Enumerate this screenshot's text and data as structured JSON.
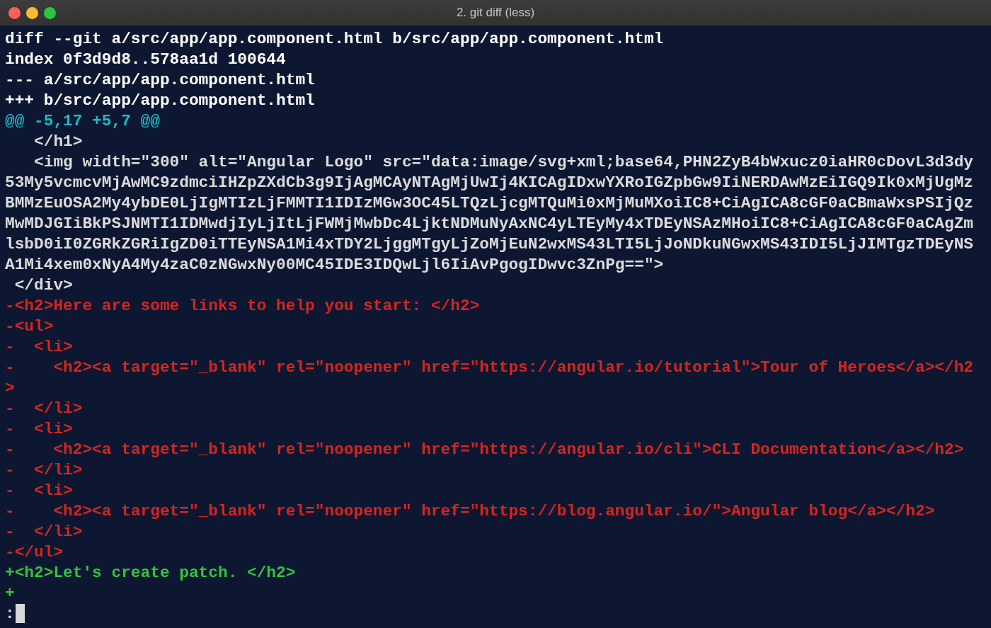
{
  "window": {
    "title": "2. git diff (less)"
  },
  "lines": [
    {
      "kind": "header",
      "text": "diff --git a/src/app/app.component.html b/src/app/app.component.html"
    },
    {
      "kind": "header",
      "text": "index 0f3d9d8..578aa1d 100644"
    },
    {
      "kind": "header",
      "text": "--- a/src/app/app.component.html"
    },
    {
      "kind": "header",
      "text": "+++ b/src/app/app.component.html"
    },
    {
      "kind": "hunk",
      "text": "@@ -5,17 +5,7 @@"
    },
    {
      "kind": "context",
      "text": "   </h1>"
    },
    {
      "kind": "context",
      "text": "   <img width=\"300\" alt=\"Angular Logo\" src=\"data:image/svg+xml;base64,PHN2ZyB4bWxucz0iaHR0cDovL3d3dy"
    },
    {
      "kind": "context",
      "text": "53My5vcmcvMjAwMC9zdmciIHZpZXdCb3g9IjAgMCAyNTAgMjUwIj4KICAgIDxwYXRoIGZpbGw9IiNERDAwMzEiIGQ9Ik0xMjUgMz"
    },
    {
      "kind": "context",
      "text": "BMMzEuOSA2My4ybDE0LjIgMTIzLjFMMTI1IDIzMGw3OC45LTQzLjcgMTQuMi0xMjMuMXoiIC8+CiAgICA8cGF0aCBmaWxsPSIjQz"
    },
    {
      "kind": "context",
      "text": "MwMDJGIiBkPSJNMTI1IDMwdjIyLjItLjFWMjMwbDc4LjktNDMuNyAxNC4yLTEyMy4xTDEyNSAzMHoiIC8+CiAgICA8cGF0aCAgZm"
    },
    {
      "kind": "context",
      "text": "lsbD0iI0ZGRkZGRiIgZD0iTTEyNSA1Mi4xTDY2LjggMTgyLjZoMjEuN2wxMS43LTI5LjJoNDkuNGwxMS43IDI5LjJIMTgzTDEyNS"
    },
    {
      "kind": "context",
      "text": "A1Mi4xem0xNyA4My4zaC0zNGwxNy00MC45IDE3IDQwLjl6IiAvPgogIDwvc3ZnPg==\">"
    },
    {
      "kind": "context",
      "text": " </div>"
    },
    {
      "kind": "removed",
      "text": "-<h2>Here are some links to help you start: </h2>"
    },
    {
      "kind": "removed",
      "text": "-<ul>"
    },
    {
      "kind": "removed",
      "text": "-  <li>"
    },
    {
      "kind": "removed",
      "text": "-    <h2><a target=\"_blank\" rel=\"noopener\" href=\"https://angular.io/tutorial\">Tour of Heroes</a></h2"
    },
    {
      "kind": "removed",
      "text": ">"
    },
    {
      "kind": "removed",
      "text": "-  </li>"
    },
    {
      "kind": "removed",
      "text": "-  <li>"
    },
    {
      "kind": "removed",
      "text": "-    <h2><a target=\"_blank\" rel=\"noopener\" href=\"https://angular.io/cli\">CLI Documentation</a></h2>"
    },
    {
      "kind": "removed",
      "text": "-  </li>"
    },
    {
      "kind": "removed",
      "text": "-  <li>"
    },
    {
      "kind": "removed",
      "text": "-    <h2><a target=\"_blank\" rel=\"noopener\" href=\"https://blog.angular.io/\">Angular blog</a></h2>"
    },
    {
      "kind": "removed",
      "text": "-  </li>"
    },
    {
      "kind": "removed",
      "text": "-</ul>"
    },
    {
      "kind": "added",
      "text": "+<h2>Let's create patch. </h2>"
    },
    {
      "kind": "added",
      "text": "+"
    }
  ],
  "prompt": {
    "text": ":"
  }
}
